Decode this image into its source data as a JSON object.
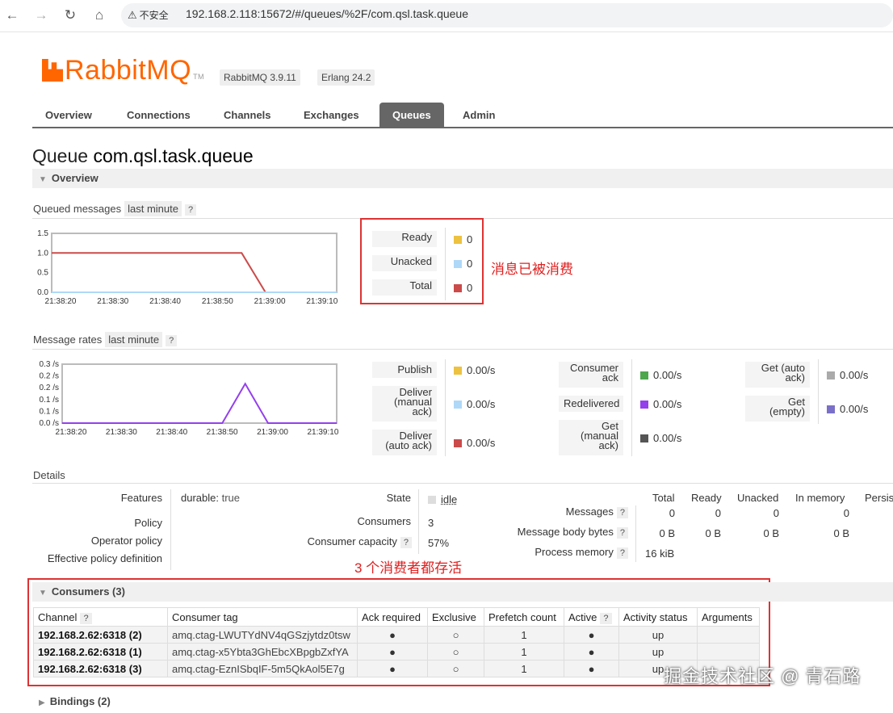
{
  "browser": {
    "security_label": "不安全",
    "url": "192.168.2.118:15672/#/queues/%2F/com.qsl.task.queue",
    "back_icon": "arrow-left-icon",
    "forward_icon": "arrow-right-icon",
    "reload_icon": "reload-icon",
    "home_icon": "home-icon"
  },
  "header": {
    "logo_text": "RabbitMQ",
    "logo_tm": "TM",
    "rabbitmq_version": "RabbitMQ 3.9.11",
    "erlang_version": "Erlang 24.2",
    "brand_color": "#ff6600"
  },
  "tabs": [
    {
      "label": "Overview"
    },
    {
      "label": "Connections"
    },
    {
      "label": "Channels"
    },
    {
      "label": "Exchanges"
    },
    {
      "label": "Queues",
      "active": true
    },
    {
      "label": "Admin"
    }
  ],
  "page": {
    "title_prefix": "Queue",
    "queue_name": "com.qsl.task.queue",
    "overview_section": "Overview"
  },
  "queued_messages": {
    "label": "Queued messages",
    "range": "last minute",
    "help": "?",
    "legend": [
      {
        "label": "Ready",
        "value": "0",
        "color": "#edc240"
      },
      {
        "label": "Unacked",
        "value": "0",
        "color": "#afd8f8"
      },
      {
        "label": "Total",
        "value": "0",
        "color": "#cb4b4b"
      }
    ]
  },
  "message_rates": {
    "label": "Message rates",
    "range": "last minute",
    "help": "?",
    "col1": [
      {
        "label": "Publish",
        "value": "0.00/s",
        "color": "#edc240"
      },
      {
        "label": "Deliver (manual ack)",
        "value": "0.00/s",
        "color": "#afd8f8"
      },
      {
        "label": "Deliver (auto ack)",
        "value": "0.00/s",
        "color": "#cb4b4b"
      }
    ],
    "col2": [
      {
        "label": "Consumer ack",
        "value": "0.00/s",
        "color": "#4da74d"
      },
      {
        "label": "Redelivered",
        "value": "0.00/s",
        "color": "#9440ed"
      },
      {
        "label": "Get (manual ack)",
        "value": "0.00/s",
        "color": "#555555"
      }
    ],
    "col3": [
      {
        "label": "Get (auto ack)",
        "value": "0.00/s",
        "color": "#aaaaaa"
      },
      {
        "label": "Get (empty)",
        "value": "0.00/s",
        "color": "#7a70c8"
      }
    ]
  },
  "chart_data": [
    {
      "type": "line",
      "x": [
        "21:38:20",
        "21:38:30",
        "21:38:40",
        "21:38:50",
        "21:39:00",
        "21:39:10"
      ],
      "yticks": [
        "1.5",
        "1.0",
        "0.5",
        "0.0"
      ],
      "ylim": [
        0,
        1.5
      ],
      "series": [
        {
          "name": "Total",
          "color": "#cb4b4b",
          "points": [
            [
              0,
              1.0
            ],
            [
              40,
              1.0
            ],
            [
              45,
              0.0
            ],
            [
              60,
              0.0
            ]
          ]
        },
        {
          "name": "Unacked",
          "color": "#afd8f8",
          "points": [
            [
              0,
              0.0
            ],
            [
              60,
              0.0
            ]
          ]
        }
      ]
    },
    {
      "type": "line",
      "x": [
        "21:38:20",
        "21:38:30",
        "21:38:40",
        "21:38:50",
        "21:39:00",
        "21:39:10"
      ],
      "yticks": [
        "0.3 /s",
        "0.2 /s",
        "0.2 /s",
        "0.1 /s",
        "0.1 /s",
        "0.0 /s"
      ],
      "ylim": [
        0,
        0.3
      ],
      "series": [
        {
          "name": "Redelivered",
          "color": "#9440ed",
          "points": [
            [
              0,
              0
            ],
            [
              35,
              0
            ],
            [
              40,
              0.2
            ],
            [
              45,
              0
            ],
            [
              60,
              0
            ]
          ]
        }
      ]
    }
  ],
  "annotations": {
    "consumed_note": "消息已被消费",
    "consumers_note": "3 个消费者都存活"
  },
  "details": {
    "section_label": "Details",
    "features_label": "Features",
    "durable_key": "durable:",
    "durable_value": "true",
    "policy_label": "Policy",
    "operator_policy_label": "Operator policy",
    "effective_policy_label": "Effective policy definition",
    "state_label": "State",
    "state_value": "idle",
    "consumers_label": "Consumers",
    "consumers_value": "3",
    "capacity_label": "Consumer capacity",
    "capacity_help": "?",
    "capacity_value": "57%",
    "col_headers": [
      "Total",
      "Ready",
      "Unacked",
      "In memory",
      "Persis"
    ],
    "messages_label": "Messages",
    "messages_values": [
      "0",
      "0",
      "0",
      "0"
    ],
    "body_bytes_label": "Message body bytes",
    "body_bytes_values": [
      "0 B",
      "0 B",
      "0 B",
      "0 B"
    ],
    "process_memory_label": "Process memory",
    "process_memory_value": "16 kiB",
    "help": "?"
  },
  "consumers": {
    "section_label": "Consumers (3)",
    "headers": [
      "Channel",
      "Consumer tag",
      "Ack required",
      "Exclusive",
      "Prefetch count",
      "Active",
      "Activity status",
      "Arguments"
    ],
    "header_help": "?",
    "rows": [
      {
        "channel": "192.168.2.62:6318 (2)",
        "tag": "amq.ctag-LWUTYdNV4qGSzjytdz0tsw",
        "ack": "●",
        "exclusive": "○",
        "prefetch": "1",
        "active": "●",
        "status": "up",
        "args": ""
      },
      {
        "channel": "192.168.2.62:6318 (1)",
        "tag": "amq.ctag-x5Ybta3GhEbcXBpgbZxfYA",
        "ack": "●",
        "exclusive": "○",
        "prefetch": "1",
        "active": "●",
        "status": "up",
        "args": ""
      },
      {
        "channel": "192.168.2.62:6318 (3)",
        "tag": "amq.ctag-EznISbqIF-5m5QkAol5E7g",
        "ack": "●",
        "exclusive": "○",
        "prefetch": "1",
        "active": "●",
        "status": "up",
        "args": ""
      }
    ]
  },
  "bindings": {
    "section_label": "Bindings (2)"
  },
  "watermark": "掘金技术社区 @ 青石路"
}
